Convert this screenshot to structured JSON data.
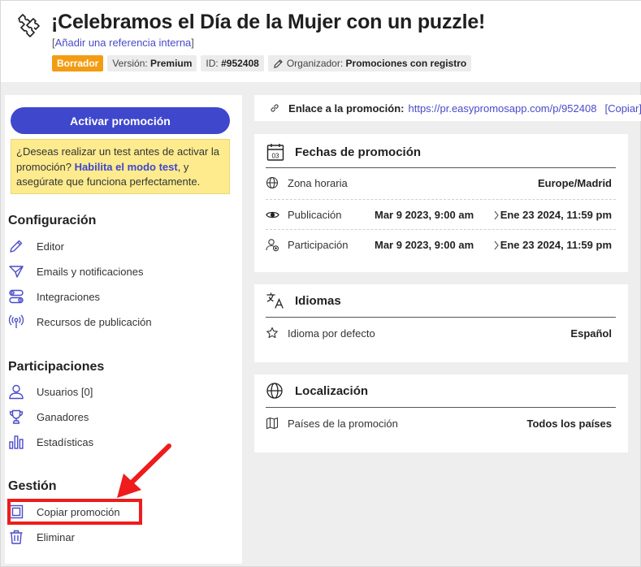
{
  "header": {
    "title": "¡Celebramos el Día de la Mujer con un puzzle!",
    "internal_ref_link": "Añadir una referencia interna",
    "status_badge": "Borrador",
    "version_label": "Versión:",
    "version_value": "Premium",
    "id_label": "ID:",
    "id_value": "#952408",
    "organizer_label": "Organizador:",
    "organizer_value": "Promociones con registro"
  },
  "sidebar": {
    "activate_button": "Activar promoción",
    "test_text_before": "¿Deseas realizar un test antes de activar la promoción?",
    "test_link": "Habilita el modo test",
    "test_text_after": ", y asegúrate que funciona perfectamente.",
    "sections": {
      "config_title": "Configuración",
      "participations_title": "Participaciones",
      "management_title": "Gestión"
    },
    "items": {
      "editor": "Editor",
      "emails": "Emails y notificaciones",
      "integrations": "Integraciones",
      "resources": "Recursos de publicación",
      "users": "Usuarios [0]",
      "winners": "Ganadores",
      "statistics": "Estadísticas",
      "copy": "Copiar promoción",
      "delete": "Eliminar"
    }
  },
  "link_bar": {
    "label": "Enlace a la promoción:",
    "url": "https://pr.easypromosapp.com/p/952408",
    "copy": "[Copiar]"
  },
  "dates_card": {
    "title": "Fechas de promoción",
    "calendar_day": "03",
    "timezone_label": "Zona horaria",
    "timezone_value": "Europe/Madrid",
    "publication_label": "Publicación",
    "publication_start": "Mar 9 2023, 9:00 am",
    "publication_end": "Ene 23 2024, 11:59 pm",
    "participation_label": "Participación",
    "participation_start": "Mar 9 2023, 9:00 am",
    "participation_end": "Ene 23 2024, 11:59 pm"
  },
  "languages_card": {
    "title": "Idiomas",
    "default_label": "Idioma por defecto",
    "default_value": "Español"
  },
  "location_card": {
    "title": "Localización",
    "countries_label": "Países de la promoción",
    "countries_value": "Todos los países"
  },
  "colors": {
    "primary": "#3f47cc",
    "draft_badge": "#f39c12",
    "test_box": "#fdeb8e",
    "highlight": "#ee1c1c"
  }
}
